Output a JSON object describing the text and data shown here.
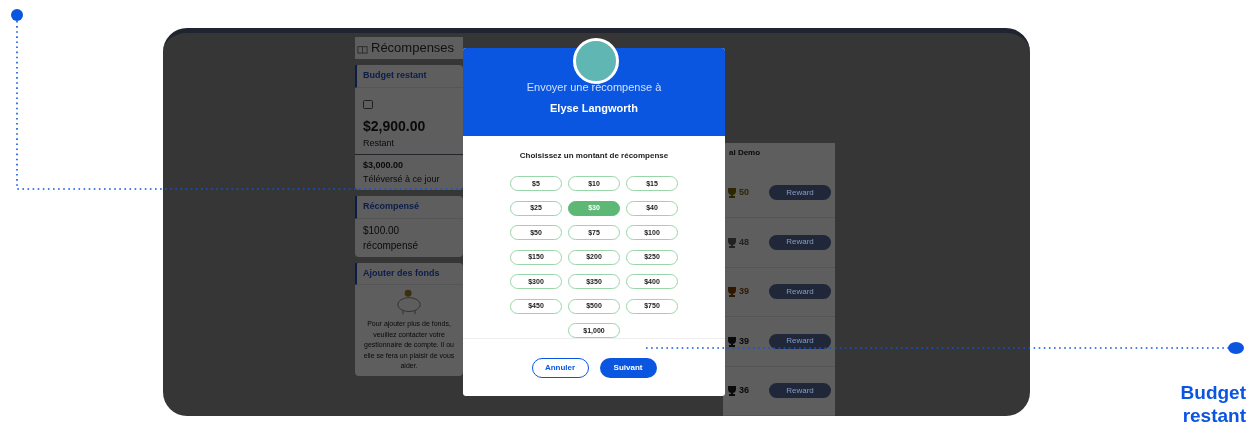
{
  "annotation": {
    "label": "Budget restant"
  },
  "page": {
    "title": "Récompenses",
    "budget": {
      "heading": "Budget restant",
      "amount": "$2,900.00",
      "amount_label": "Restant",
      "uploaded": "$3,000.00",
      "uploaded_label": "Téléversé à ce jour"
    },
    "rewarded": {
      "heading": "Récompensé",
      "amount": "$100.00",
      "label": "récompensé"
    },
    "funds": {
      "heading": "Ajouter des fonds",
      "text": "Pour ajouter plus de fonds, veuillez contacter votre gestionnaire de compte. Il ou elle se fera un plaisir de vous aider."
    },
    "column_header": "al Demo",
    "rows": [
      {
        "count": "50",
        "color": "#2e2600",
        "button": "Reward"
      },
      {
        "count": "48",
        "color": "#222222",
        "button": "Reward"
      },
      {
        "count": "39",
        "color": "#301800",
        "button": "Reward"
      },
      {
        "count": "39",
        "color": "#0a0a0a",
        "button": "Reward"
      },
      {
        "count": "36",
        "color": "#0a0a0a",
        "button": "Reward"
      }
    ]
  },
  "modal": {
    "title": "Envoyer une récompense à",
    "recipient": "Elyse Langworth",
    "prompt": "Choisissez un montant de récompense",
    "amounts": [
      {
        "label": "$5",
        "selected": false
      },
      {
        "label": "$10",
        "selected": false
      },
      {
        "label": "$15",
        "selected": false
      },
      {
        "label": "$25",
        "selected": false
      },
      {
        "label": "$30",
        "selected": true
      },
      {
        "label": "$40",
        "selected": false
      },
      {
        "label": "$50",
        "selected": false
      },
      {
        "label": "$75",
        "selected": false
      },
      {
        "label": "$100",
        "selected": false
      },
      {
        "label": "$150",
        "selected": false
      },
      {
        "label": "$200",
        "selected": false
      },
      {
        "label": "$250",
        "selected": false
      },
      {
        "label": "$300",
        "selected": false
      },
      {
        "label": "$350",
        "selected": false
      },
      {
        "label": "$400",
        "selected": false
      },
      {
        "label": "$450",
        "selected": false
      },
      {
        "label": "$500",
        "selected": false
      },
      {
        "label": "$750",
        "selected": false
      },
      {
        "label": "$1,000",
        "selected": false
      }
    ],
    "cancel": "Annuler",
    "next": "Suivant"
  }
}
